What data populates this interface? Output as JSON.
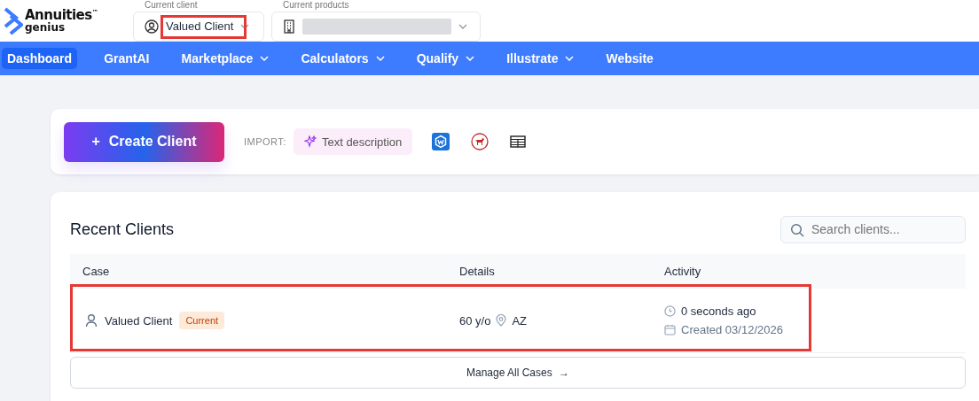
{
  "logo": {
    "name": "Annuities",
    "mark": "™",
    "sub": "genius"
  },
  "client_selector": {
    "label": "Current client",
    "value": "Valued Client",
    "highlighted": true
  },
  "product_selector": {
    "label": "Current products"
  },
  "nav": [
    {
      "label": "Dashboard",
      "selected": true,
      "dropdown": false
    },
    {
      "label": "GrantAI",
      "selected": false,
      "dropdown": false
    },
    {
      "label": "Marketplace",
      "selected": false,
      "dropdown": true
    },
    {
      "label": "Calculators",
      "selected": false,
      "dropdown": true
    },
    {
      "label": "Qualify",
      "selected": false,
      "dropdown": true
    },
    {
      "label": "Illustrate",
      "selected": false,
      "dropdown": true
    },
    {
      "label": "Website",
      "selected": false,
      "dropdown": false
    }
  ],
  "create_button": "Create Client",
  "create_icon": "+",
  "import": {
    "label": "IMPORT:",
    "text_button": "Text description"
  },
  "recent": {
    "title": "Recent Clients",
    "search_placeholder": "Search clients...",
    "columns": [
      "Case",
      "Details",
      "Activity"
    ],
    "rows": [
      {
        "name": "Valued Client",
        "badge": "Current",
        "age": "60 y/o",
        "state": "AZ",
        "last_activity": "0 seconds ago",
        "created": "Created 03/12/2026",
        "highlighted": true
      }
    ],
    "manage_button": "Manage All Cases",
    "manage_arrow": "→"
  }
}
